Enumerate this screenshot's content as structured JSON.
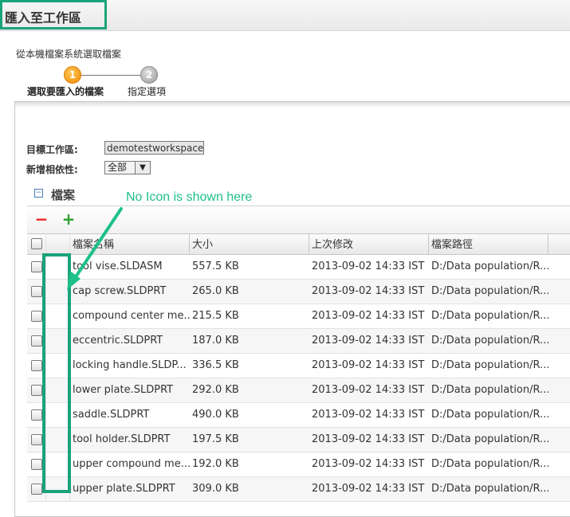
{
  "window": {
    "title": "匯入至工作區"
  },
  "source_label": "從本機檔案系統選取檔案",
  "steps": [
    {
      "number": "1",
      "label": "選取要匯入的檔案"
    },
    {
      "number": "2",
      "label": "指定選項"
    }
  ],
  "form": {
    "workspace_label": "目標工作區:",
    "workspace_value": "demotestworkspace",
    "dependency_label": "新增相依性:",
    "dependency_value": "全部"
  },
  "files_section": {
    "title": "檔案",
    "toggle": "−",
    "remove_icon": "minus-icon",
    "add_icon": "plus-icon"
  },
  "annotation": {
    "text": "No Icon is shown here",
    "color": "#1ec08a"
  },
  "table": {
    "columns": {
      "name": "檔案名稱",
      "size": "大小",
      "modified": "上次修改",
      "path": "檔案路徑"
    },
    "rows": [
      {
        "name": "tool vise.SLDASM",
        "size": "557.5 KB",
        "modified": "2013-09-02 14:33 IST",
        "path": "D:/Data population/R..."
      },
      {
        "name": "cap screw.SLDPRT",
        "size": "265.0 KB",
        "modified": "2013-09-02 14:33 IST",
        "path": "D:/Data population/R..."
      },
      {
        "name": "compound center me...",
        "size": "215.5 KB",
        "modified": "2013-09-02 14:33 IST",
        "path": "D:/Data population/R..."
      },
      {
        "name": "eccentric.SLDPRT",
        "size": "187.0 KB",
        "modified": "2013-09-02 14:33 IST",
        "path": "D:/Data population/R..."
      },
      {
        "name": "locking handle.SLDP...",
        "size": "336.5 KB",
        "modified": "2013-09-02 14:33 IST",
        "path": "D:/Data population/R..."
      },
      {
        "name": "lower plate.SLDPRT",
        "size": "292.0 KB",
        "modified": "2013-09-02 14:33 IST",
        "path": "D:/Data population/R..."
      },
      {
        "name": "saddle.SLDPRT",
        "size": "490.0 KB",
        "modified": "2013-09-02 14:33 IST",
        "path": "D:/Data population/R..."
      },
      {
        "name": "tool holder.SLDPRT",
        "size": "197.5 KB",
        "modified": "2013-09-02 14:33 IST",
        "path": "D:/Data population/R..."
      },
      {
        "name": "upper compound me...",
        "size": "192.0 KB",
        "modified": "2013-09-02 14:33 IST",
        "path": "D:/Data population/R..."
      },
      {
        "name": "upper plate.SLDPRT",
        "size": "309.0 KB",
        "modified": "2013-09-02 14:33 IST",
        "path": "D:/Data population/R..."
      }
    ]
  },
  "colors": {
    "highlight": "#1aa37a",
    "step_active": "#f08a00",
    "step_inactive": "#9a9a9a"
  }
}
